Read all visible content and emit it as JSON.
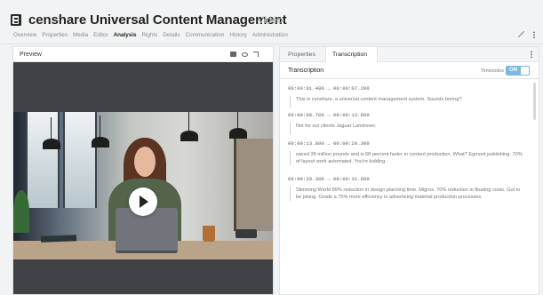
{
  "header": {
    "title": "censhare Universal Content Management",
    "asset_type": "Video",
    "icon": "asset-video-icon"
  },
  "nav_tabs": [
    {
      "label": "Overview",
      "active": false
    },
    {
      "label": "Properties",
      "active": false
    },
    {
      "label": "Media",
      "active": false
    },
    {
      "label": "Editor",
      "active": false
    },
    {
      "label": "Analysis",
      "active": true
    },
    {
      "label": "Rights",
      "active": false
    },
    {
      "label": "Details",
      "active": false
    },
    {
      "label": "Communication",
      "active": false
    },
    {
      "label": "History",
      "active": false
    },
    {
      "label": "Administration",
      "active": false
    }
  ],
  "preview": {
    "title": "Preview",
    "tools": [
      "camera-icon",
      "eye-icon",
      "fullscreen-icon"
    ]
  },
  "right_panel": {
    "tabs": [
      {
        "label": "Properties",
        "active": false
      },
      {
        "label": "Transcription",
        "active": true
      }
    ],
    "section_title": "Transcription",
    "timecodes_label": "Timecodes",
    "toggle_label": "ON",
    "entries": [
      {
        "timecode": "00:00:01.400 → 00:00:07.200",
        "text": "This is censhare, a universal content management system. Sounds boring?"
      },
      {
        "timecode": "00:00:08.700 → 00:00:13.800",
        "text": "Not for our clients Jaguar Landrover."
      },
      {
        "timecode": "00:00:13.800 → 00:00:20.300",
        "text": "saved 35 million pounds and is 68 percent faster in content production. What? Egmont publishing. 70% of layout work automated. You're kidding."
      },
      {
        "timecode": "00:00:20.300 → 00:00:31.800",
        "text": "Slimming World 89% reduction in design planning time. Migros. 70% reduction in floating costs. Got to be joking. Grade a 75% more efficiency in advertising material production processes."
      }
    ]
  },
  "colors": {
    "toggle_on": "#7db8df",
    "background": "#f2f3f4",
    "video_background": "#3f4245"
  }
}
